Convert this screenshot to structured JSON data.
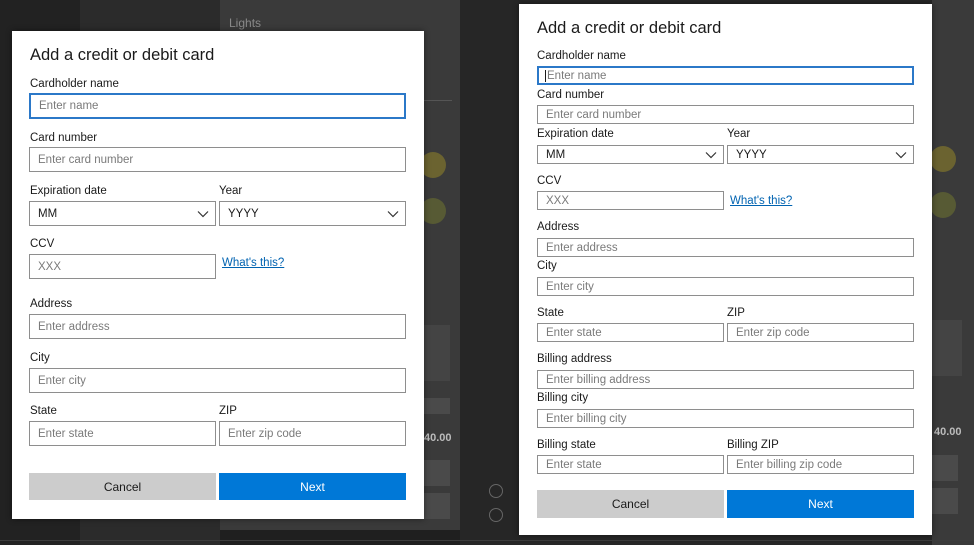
{
  "background": {
    "lights_label": "Lights",
    "price_left": "40.00",
    "price_right": "40.00"
  },
  "dialog_left": {
    "title": "Add a credit or debit card",
    "cardholder_label": "Cardholder name",
    "cardholder_placeholder": "Enter name",
    "card_number_label": "Card number",
    "card_number_placeholder": "Enter card number",
    "expiration_label": "Expiration date",
    "expiration_value": "MM",
    "year_label": "Year",
    "year_value": "YYYY",
    "ccv_label": "CCV",
    "ccv_placeholder": "XXX",
    "whats_this": "What's this?",
    "address_label": "Address",
    "address_placeholder": "Enter address",
    "city_label": "City",
    "city_placeholder": "Enter city",
    "state_label": "State",
    "state_placeholder": "Enter state",
    "zip_label": "ZIP",
    "zip_placeholder": "Enter zip code",
    "cancel": "Cancel",
    "next": "Next"
  },
  "dialog_right": {
    "title": "Add a credit or debit card",
    "cardholder_label": "Cardholder name",
    "cardholder_placeholder": "Enter name",
    "card_number_label": "Card number",
    "card_number_placeholder": "Enter card number",
    "expiration_label": "Expiration date",
    "expiration_value": "MM",
    "year_label": "Year",
    "year_value": "YYYY",
    "ccv_label": "CCV",
    "ccv_placeholder": "XXX",
    "whats_this": "What's this?",
    "address_label": "Address",
    "address_placeholder": "Enter address",
    "city_label": "City",
    "city_placeholder": "Enter city",
    "state_label": "State",
    "state_placeholder": "Enter state",
    "zip_label": "ZIP",
    "zip_placeholder": "Enter zip code",
    "billing_address_label": "Billing address",
    "billing_address_placeholder": "Enter billing address",
    "billing_city_label": "Billing city",
    "billing_city_placeholder": "Enter billing city",
    "billing_state_label": "Billing state",
    "billing_state_placeholder": "Enter state",
    "billing_zip_label": "Billing ZIP",
    "billing_zip_placeholder": "Enter billing zip code",
    "cancel": "Cancel",
    "next": "Next"
  },
  "colors": {
    "accent": "#0078d7",
    "link": "#0063b1",
    "focus_border": "#2b78c8",
    "cancel_bg": "#cccccc"
  }
}
